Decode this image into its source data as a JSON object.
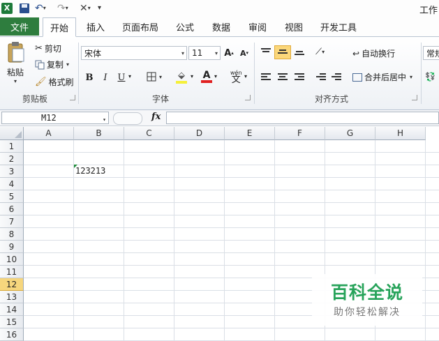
{
  "window": {
    "title_partial": "工作"
  },
  "tabs": {
    "file": "文件",
    "items": [
      "开始",
      "插入",
      "页面布局",
      "公式",
      "数据",
      "审阅",
      "视图",
      "开发工具"
    ],
    "active": "开始"
  },
  "ribbon": {
    "clipboard": {
      "label": "剪贴板",
      "paste": "粘贴",
      "cut": "剪切",
      "copy": "复制",
      "format_painter": "格式刷"
    },
    "font": {
      "label": "字体",
      "font_name": "宋体",
      "font_size": "11",
      "bold": "B",
      "italic": "I",
      "underline": "U",
      "phonetic": "wén"
    },
    "alignment": {
      "label": "对齐方式",
      "wrap_text": "自动换行",
      "merge_center": "合并后居中"
    },
    "number": {
      "format_partial": "常规"
    }
  },
  "formula_bar": {
    "name_box": "M12",
    "fx": "fx",
    "value": ""
  },
  "sheet": {
    "columns": [
      "A",
      "B",
      "C",
      "D",
      "E",
      "F",
      "G",
      "H"
    ],
    "rows": [
      "1",
      "2",
      "3",
      "4",
      "5",
      "6",
      "7",
      "8",
      "9",
      "10",
      "11",
      "12",
      "13",
      "14",
      "15",
      "16"
    ],
    "selected_row": "12",
    "cells": {
      "B3": "123213"
    }
  },
  "watermark": {
    "title": "百科全说",
    "subtitle": "助你轻松解决"
  },
  "colors": {
    "file_tab": "#2e7d3e",
    "selected_row_header": "#f6d67d",
    "watermark_green": "#27a35a"
  }
}
